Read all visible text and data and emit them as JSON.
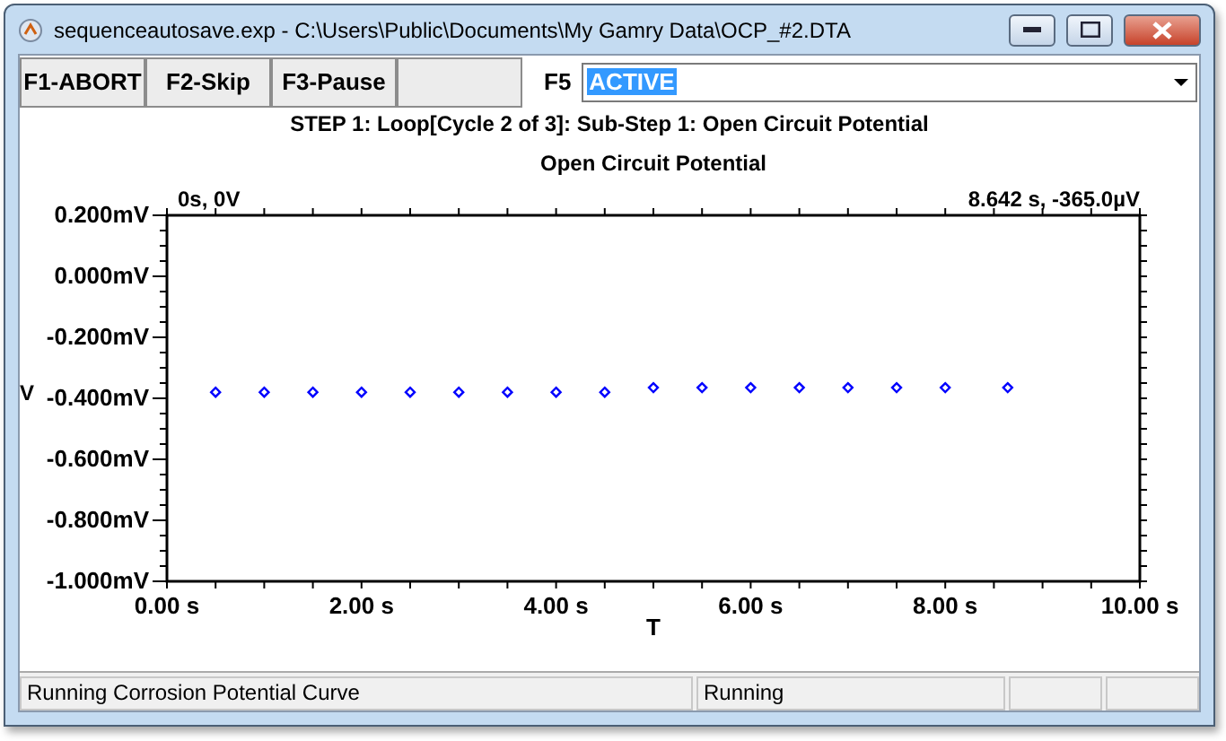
{
  "window": {
    "title": "sequenceautosave.exp - C:\\Users\\Public\\Documents\\My Gamry Data\\OCP_#2.DTA"
  },
  "toolbar": {
    "buttons": [
      {
        "label": "F1-ABORT"
      },
      {
        "label": "F2-Skip"
      },
      {
        "label": "F3-Pause"
      }
    ],
    "combo_label": "F5",
    "combo_value": "ACTIVE"
  },
  "step": "STEP 1: Loop[Cycle 2 of 3]: Sub-Step 1: Open Circuit Potential",
  "chart": {
    "chart_data": {
      "type": "scatter",
      "title": "Open Circuit Potential",
      "xlabel": "T",
      "ylabel": "V",
      "xlim": [
        0,
        10
      ],
      "ylim": [
        -1.0,
        0.2
      ],
      "xticks": [
        {
          "value": 0,
          "label": "0.00 s"
        },
        {
          "value": 2,
          "label": "2.00 s"
        },
        {
          "value": 4,
          "label": "4.00 s"
        },
        {
          "value": 6,
          "label": "6.00 s"
        },
        {
          "value": 8,
          "label": "8.00 s"
        },
        {
          "value": 10,
          "label": "10.00 s"
        }
      ],
      "yticks": [
        {
          "value": 0.2,
          "label": "0.200mV"
        },
        {
          "value": 0,
          "label": "0.000mV"
        },
        {
          "value": -0.2,
          "label": "-0.200mV"
        },
        {
          "value": -0.4,
          "label": "-0.400mV"
        },
        {
          "value": -0.6,
          "label": "-0.600mV"
        },
        {
          "value": -0.8,
          "label": "-0.800mV"
        },
        {
          "value": -1.0,
          "label": "-1.000mV"
        }
      ],
      "x": [
        0.5,
        1.0,
        1.5,
        2.0,
        2.5,
        3.0,
        3.5,
        4.0,
        4.5,
        5.0,
        5.5,
        6.0,
        6.5,
        7.0,
        7.5,
        8.0,
        8.642
      ],
      "series": [
        {
          "color": "#0000ff",
          "values": [
            -0.38,
            -0.38,
            -0.38,
            -0.38,
            -0.38,
            -0.38,
            -0.38,
            -0.38,
            -0.38,
            -0.365,
            -0.365,
            -0.365,
            -0.365,
            -0.365,
            -0.365,
            -0.365,
            -0.365
          ]
        }
      ],
      "annotations": [
        {
          "text": "0s, 0V"
        },
        {
          "text": "8.642 s, -365.0µV"
        }
      ]
    }
  },
  "status_bar": [
    "Running Corrosion Potential Curve",
    "Running"
  ]
}
